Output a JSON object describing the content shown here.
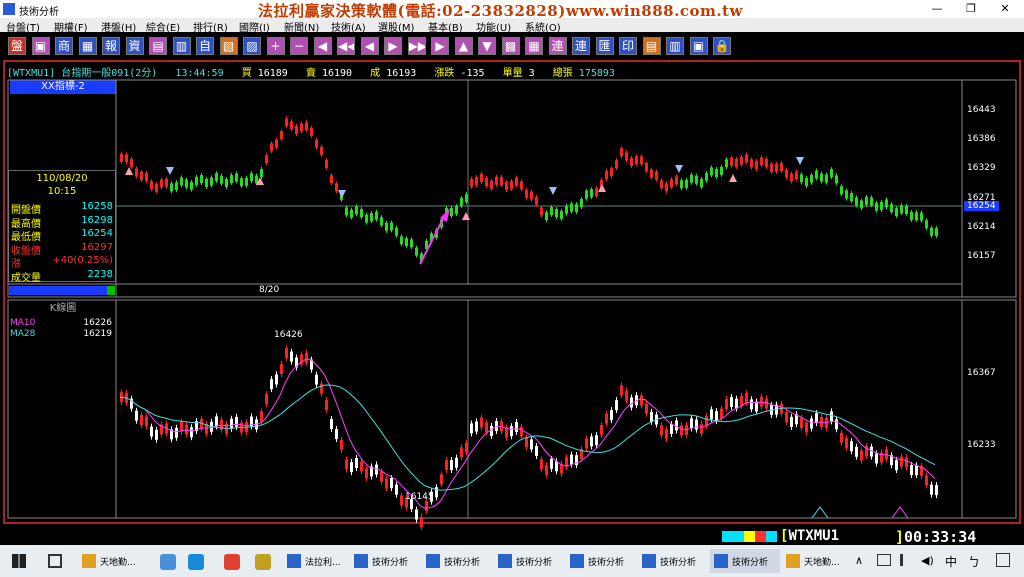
{
  "window": {
    "title": "技術分析",
    "controls": [
      "—",
      "❐",
      "✕"
    ]
  },
  "banner": "法拉利贏家決策軟體(電話:02-23832828)www.win888.com.tw",
  "menu": [
    "台盤(T)",
    "期權(F)",
    "港盤(H)",
    "綜合(E)",
    "排行(R)",
    "國際(I)",
    "新聞(N)",
    "技術(A)",
    "選股(M)",
    "基本(B)",
    "功能(U)",
    "系統(O)"
  ],
  "toolbar": [
    "盤",
    "▣",
    "商",
    "▦",
    "報",
    "資",
    "▤",
    "▥",
    "自",
    "▧",
    "▨",
    "+",
    "−",
    "◀",
    "◀◀",
    "◀",
    "▶",
    "▶▶",
    "▶",
    "▲",
    "▼",
    "▩",
    "▦",
    "連",
    "連",
    "匯",
    "印",
    "▤",
    "▥",
    "▣",
    "🔒"
  ],
  "quote": {
    "symbol": "[WTXMU1]",
    "name": "台指期一般091(2分)",
    "time": "13:44:59",
    "bid_label": "買",
    "bid": "16189",
    "ask_label": "賣",
    "ask": "16190",
    "deal_label": "成",
    "deal": "16193",
    "chg_label": "漲跌",
    "chg": "-135",
    "vol_label": "單量",
    "vol": "3",
    "total_label": "總張",
    "total": "175893"
  },
  "upper": {
    "header": "XX指標-2",
    "info": {
      "date": "110/08/20",
      "time": "10:15",
      "rows": [
        {
          "label": "開盤價",
          "value": "16258",
          "color": "#ffff00",
          "vcolor": "#00ffff"
        },
        {
          "label": "最高價",
          "value": "16298",
          "color": "#ffff00",
          "vcolor": "#00ffff"
        },
        {
          "label": "最低價",
          "value": "16254",
          "color": "#ffff00",
          "vcolor": "#00ffff"
        },
        {
          "label": "收盤價",
          "value": "16297",
          "color": "#ff3030",
          "vcolor": "#ff3030"
        },
        {
          "label": "漲",
          "value": "+40(0.25%)",
          "color": "#ff3030",
          "vcolor": "#ff3030"
        },
        {
          "label": "成交量",
          "value": "2238",
          "color": "#ffff00",
          "vcolor": "#00ffff"
        }
      ]
    },
    "yticks": [
      "16443",
      "16386",
      "16329",
      "16271",
      "16214",
      "16157"
    ],
    "current": "16254",
    "date_marker": "8/20"
  },
  "lower": {
    "header": "K線圖",
    "ma": [
      {
        "label": "MA10",
        "value": "16226",
        "color": "#ff40ff"
      },
      {
        "label": "MA28",
        "value": "16219",
        "color": "#40e0e0"
      }
    ],
    "yticks": [
      "16367",
      "16233"
    ],
    "high_label": "16426",
    "low_label": "16145"
  },
  "status": {
    "symbol": "WTXMU1",
    "clock": "00:33:34"
  },
  "taskbar": [
    {
      "label": "天地勤..."
    },
    {
      "label": "法拉利..."
    },
    {
      "label": "技術分析"
    },
    {
      "label": "技術分析"
    },
    {
      "label": "技術分析"
    },
    {
      "label": "技術分析"
    },
    {
      "label": "技術分析"
    },
    {
      "label": "技術分析"
    },
    {
      "label": "天地勤..."
    }
  ],
  "tray": {
    "ime": "中",
    "lang": "ㄅ",
    "up": "∧"
  }
}
